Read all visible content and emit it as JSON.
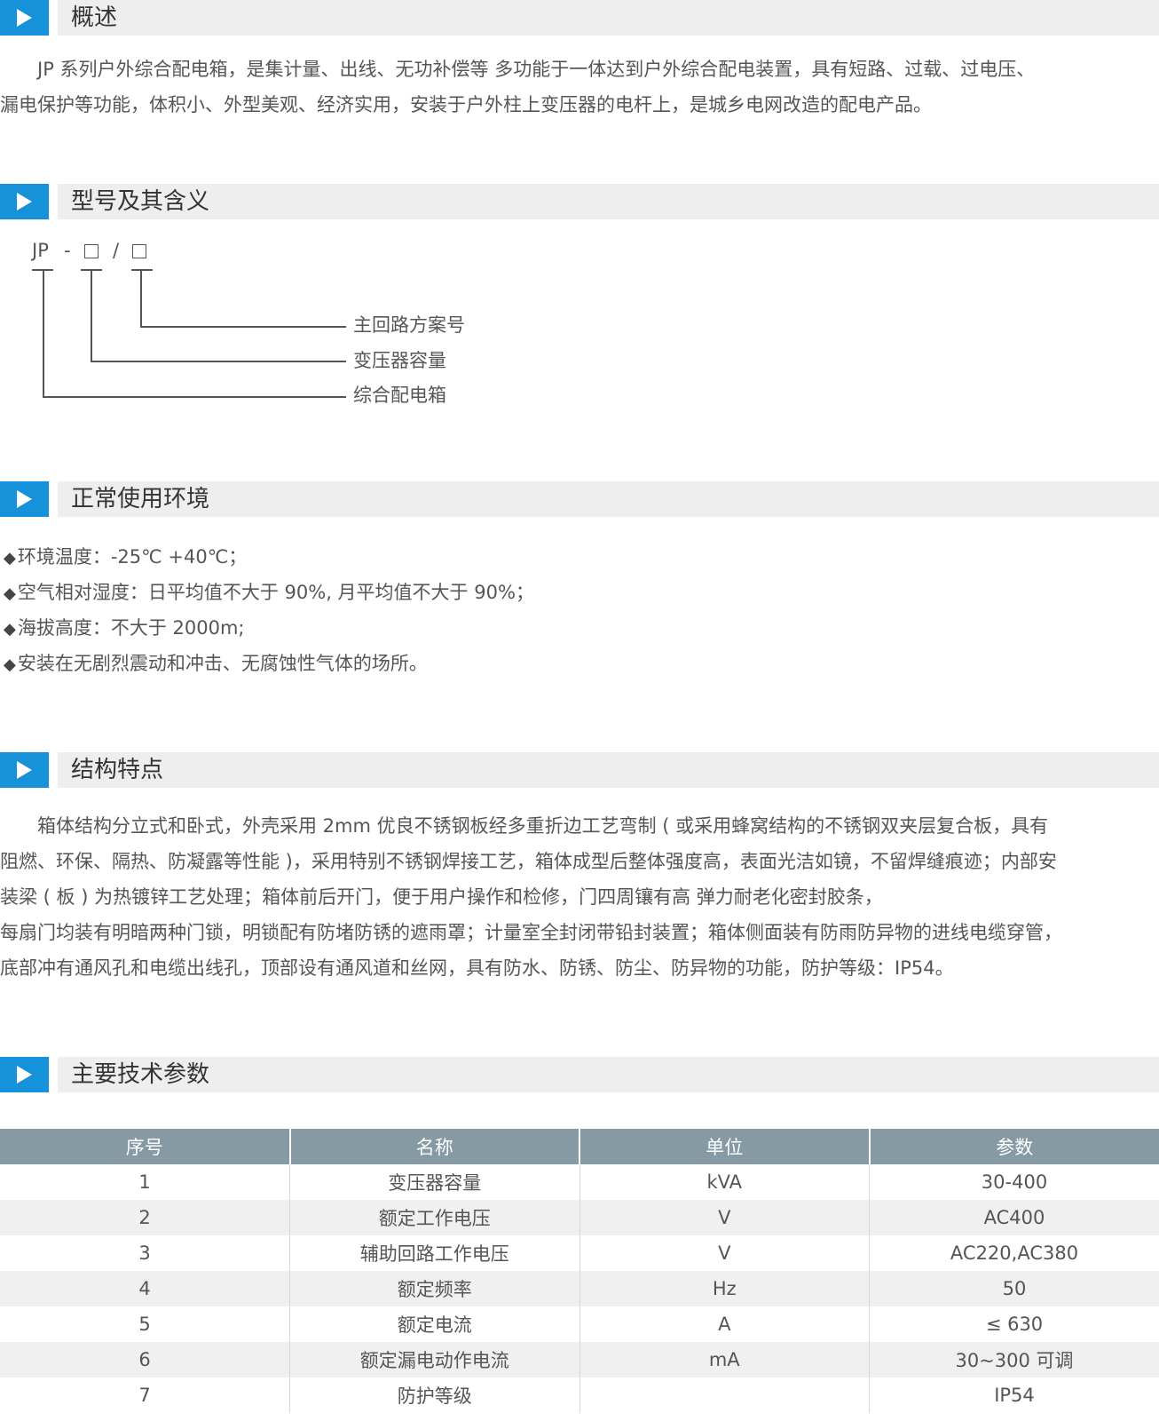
{
  "sections": {
    "overview": {
      "title": "概述",
      "lines": [
        "　　JP 系列户外综合配电箱，是集计量、出线、无功补偿等 多功能于一体达到户外综合配电装置，具有短路、过载、过电压、",
        "漏电保护等功能，体积小、外型美观、经济实用，安装于户外柱上变压器的电杆上，是城乡电网改造的配电产品。"
      ]
    },
    "model": {
      "title": "型号及其含义",
      "code_prefix": "JP",
      "code_dash": "-",
      "code_slash": "/",
      "labels": [
        "主回路方案号",
        "变压器容量",
        "综合配电箱"
      ]
    },
    "environment": {
      "title": "正常使用环境",
      "bullet_symbol": "◆",
      "items": [
        "环境温度：-25℃ +40℃；",
        "空气相对湿度：日平均值不大于 90%, 月平均值不大于 90%；",
        "海拔高度：不大于 2000m;",
        "安装在无剧烈震动和冲击、无腐蚀性气体的场所。"
      ]
    },
    "structure": {
      "title": "结构特点",
      "lines": [
        "　　箱体结构分立式和卧式，外壳采用 2mm 优良不锈钢板经多重折边工艺弯制 ( 或采用蜂窝结构的不锈钢双夹层复合板，具有",
        "阻燃、环保、隔热、防凝露等性能 )，采用特别不锈钢焊接工艺，箱体成型后整体强度高，表面光洁如镜，不留焊缝痕迹；内部安",
        "装梁 ( 板 ) 为热镀锌工艺处理；箱体前后开门，便于用户操作和检修，门四周镶有高 弹力耐老化密封胶条，",
        "每扇门均装有明暗两种门锁，明锁配有防堵防锈的遮雨罩；计量室全封闭带铅封装置；箱体侧面装有防雨防异物的进线电缆穿管，",
        "底部冲有通风孔和电缆出线孔，顶部设有通风道和丝网，具有防水、防锈、防尘、防异物的功能，防护等级：IP54。"
      ]
    },
    "params": {
      "title": "主要技术参数",
      "headers": [
        "序号",
        "名称",
        "单位",
        "参数"
      ],
      "rows": [
        [
          "1",
          "变压器容量",
          "kVA",
          "30-400"
        ],
        [
          "2",
          "额定工作电压",
          "V",
          "AC400"
        ],
        [
          "3",
          "辅助回路工作电压",
          "V",
          "AC220,AC380"
        ],
        [
          "4",
          "额定频率",
          "Hz",
          "50"
        ],
        [
          "5",
          "额定电流",
          "A",
          "≤ 630"
        ],
        [
          "6",
          "额定漏电动作电流",
          "mA",
          "30~300 可调"
        ],
        [
          "7",
          "防护等级",
          "",
          "IP54"
        ]
      ]
    }
  },
  "colors": {
    "marker": "#1592d9",
    "header_bar": "#eeeeee",
    "table_header": "#869aa3",
    "table_alt_row": "#f0f0f0",
    "text": "#555555"
  }
}
